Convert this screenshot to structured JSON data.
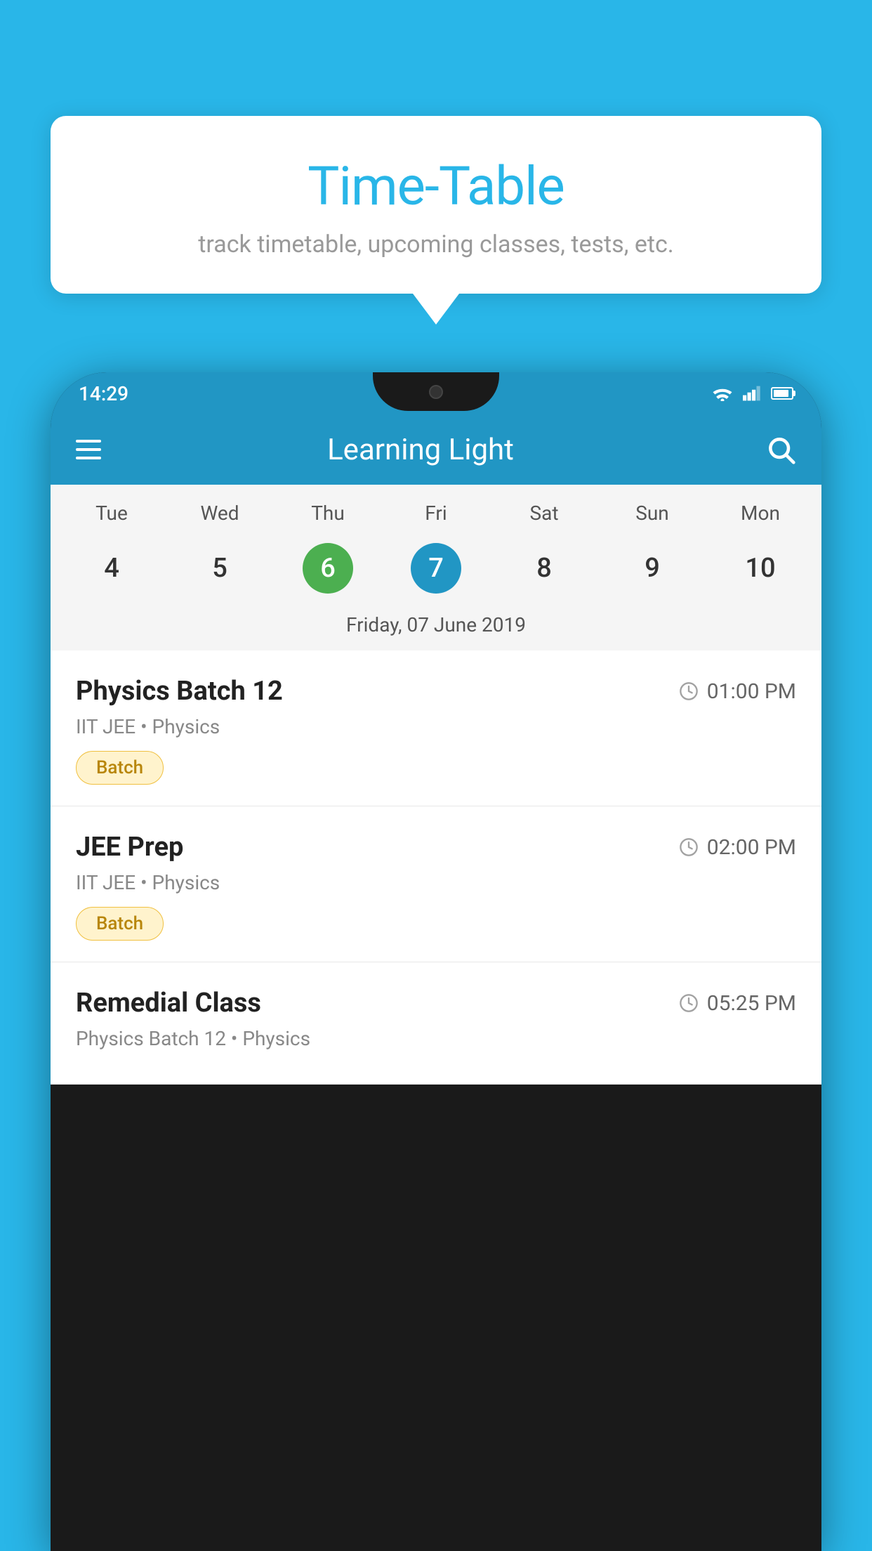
{
  "background_color": "#29b6e8",
  "tooltip": {
    "title": "Time-Table",
    "subtitle": "track timetable, upcoming classes, tests, etc."
  },
  "phone": {
    "status_bar": {
      "time": "14:29"
    },
    "app_bar": {
      "title": "Learning Light",
      "menu_icon": "hamburger-icon",
      "search_icon": "search-icon"
    },
    "calendar": {
      "days": [
        "Tue",
        "Wed",
        "Thu",
        "Fri",
        "Sat",
        "Sun",
        "Mon"
      ],
      "dates": [
        "4",
        "5",
        "6",
        "7",
        "8",
        "9",
        "10"
      ],
      "today_index": 2,
      "selected_index": 3,
      "date_label": "Friday, 07 June 2019"
    },
    "schedule": [
      {
        "title": "Physics Batch 12",
        "time": "01:00 PM",
        "subtitle": "IIT JEE • Physics",
        "badge": "Batch"
      },
      {
        "title": "JEE Prep",
        "time": "02:00 PM",
        "subtitle": "IIT JEE • Physics",
        "badge": "Batch"
      },
      {
        "title": "Remedial Class",
        "time": "05:25 PM",
        "subtitle": "Physics Batch 12 • Physics",
        "badge": null
      }
    ]
  }
}
